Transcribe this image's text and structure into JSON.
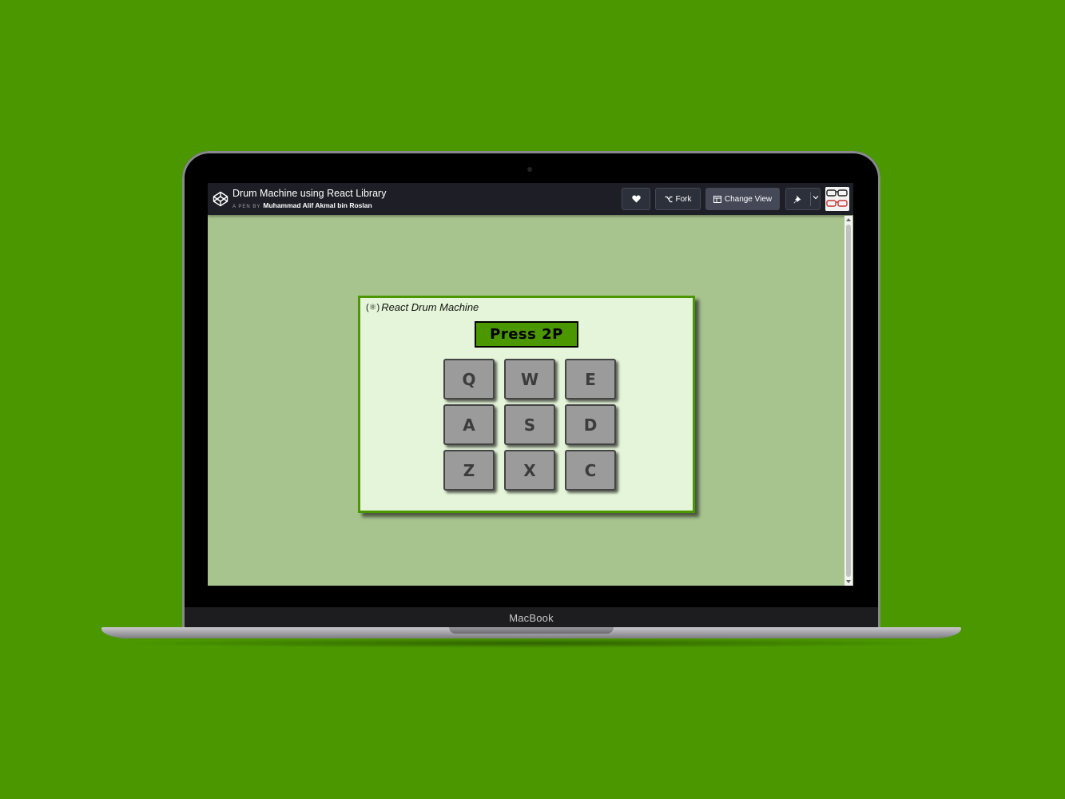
{
  "device": {
    "label": "MacBook"
  },
  "codepen": {
    "title": "Drum Machine using React Library",
    "byline_prefix": "A PEN BY",
    "author": "Muhammad Alif Akmal bin Roslan",
    "buttons": {
      "like_icon": "heart-icon",
      "fork_label": "Fork",
      "change_view_label": "Change View",
      "pin_icon": "pin-icon"
    }
  },
  "app": {
    "title": "React Drum Machine",
    "display": "Press 2P",
    "pads": [
      "Q",
      "W",
      "E",
      "A",
      "S",
      "D",
      "Z",
      "X",
      "C"
    ]
  },
  "colors": {
    "background": "#4a9700",
    "screen_bg": "#a8c48e",
    "panel_bg": "#e5f5d9",
    "accent": "#4a9700",
    "pad": "#9b9b9b"
  }
}
